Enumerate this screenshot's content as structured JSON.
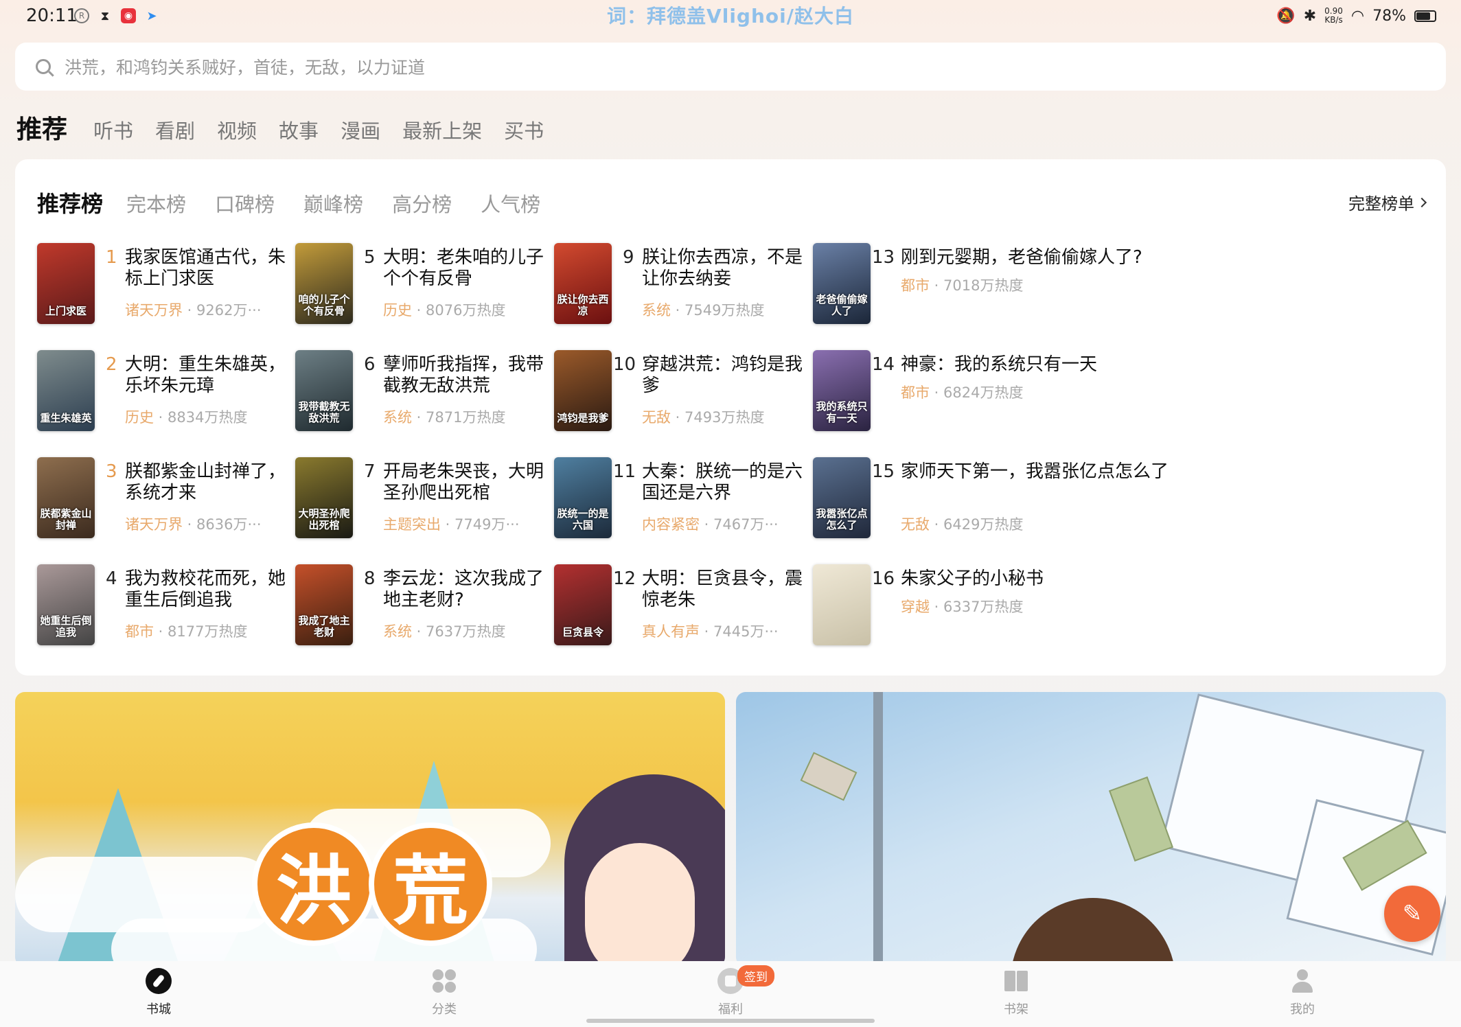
{
  "status": {
    "time": "20:11",
    "lyric": "词：拜德盖Vlighoi/赵大白",
    "net_speed": "0.90",
    "net_unit": "KB/s",
    "battery": "78%",
    "battery_level": 0.78
  },
  "search": {
    "placeholder": "洪荒，和鸿钧关系贼好，首徒，无敌，以力证道"
  },
  "channels": [
    "推荐",
    "听书",
    "看剧",
    "视频",
    "故事",
    "漫画",
    "最新上架",
    "买书"
  ],
  "rank": {
    "tabs": [
      "推荐榜",
      "完本榜",
      "口碑榜",
      "巅峰榜",
      "高分榜",
      "人气榜"
    ],
    "full_list": "完整榜单",
    "books": [
      {
        "num": "1",
        "title": "我家医馆通古代，朱标上门求医",
        "tag": "诸天万界",
        "heat": " · 9262万···",
        "cover": "上门求医"
      },
      {
        "num": "2",
        "title": "大明：重生朱雄英，乐坏朱元璋",
        "tag": "历史",
        "heat": " · 8834万热度",
        "cover": "重生朱雄英"
      },
      {
        "num": "3",
        "title": "朕都紫金山封禅了，系统才来",
        "tag": "诸天万界",
        "heat": " · 8636万···",
        "cover": "朕都紫金山封禅"
      },
      {
        "num": "4",
        "title": "我为救校花而死，她重生后倒追我",
        "tag": "都市",
        "heat": " · 8177万热度",
        "cover": "她重生后倒追我"
      },
      {
        "num": "5",
        "title": "大明：老朱咱的儿子个个有反骨",
        "tag": "历史",
        "heat": " · 8076万热度",
        "cover": "咱的儿子个个有反骨"
      },
      {
        "num": "6",
        "title": "孽师听我指挥，我带截教无敌洪荒",
        "tag": "系统",
        "heat": " · 7871万热度",
        "cover": "我带截教无敌洪荒"
      },
      {
        "num": "7",
        "title": "开局老朱哭丧，大明圣孙爬出死棺",
        "tag": "主题突出",
        "heat": " · 7749万···",
        "cover": "大明圣孙爬出死棺"
      },
      {
        "num": "8",
        "title": "李云龙：这次我成了地主老财?",
        "tag": "系统",
        "heat": " · 7637万热度",
        "cover": "我成了地主老财"
      },
      {
        "num": "9",
        "title": "朕让你去西凉，不是让你去纳妾",
        "tag": "系统",
        "heat": " · 7549万热度",
        "cover": "朕让你去西凉"
      },
      {
        "num": "10",
        "title": "穿越洪荒：鸿钧是我爹",
        "tag": "无敌",
        "heat": " · 7493万热度",
        "cover": "鸿钧是我爹"
      },
      {
        "num": "11",
        "title": "大秦：朕统一的是六国还是六界",
        "tag": "内容紧密",
        "heat": " · 7467万···",
        "cover": "朕统一的是六国"
      },
      {
        "num": "12",
        "title": "大明：巨贪县令，震惊老朱",
        "tag": "真人有声",
        "heat": " · 7445万···",
        "cover": "巨贪县令"
      },
      {
        "num": "13",
        "title": "刚到元婴期，老爸偷偷嫁人了?",
        "tag": "都市",
        "heat": " · 7018万热度",
        "cover": "老爸偷偷嫁人了"
      },
      {
        "num": "14",
        "title": "神豪：我的系统只有一天",
        "tag": "都市",
        "heat": " · 6824万热度",
        "cover": "我的系统只有一天"
      },
      {
        "num": "15",
        "title": "家师天下第一，我嚣张亿点怎么了",
        "tag": "无敌",
        "heat": " · 6429万热度",
        "cover": "我嚣张亿点怎么了"
      },
      {
        "num": "16",
        "title": "朱家父子的小秘书",
        "tag": "穿越",
        "heat": " · 6337万热度",
        "cover": ""
      }
    ]
  },
  "banners": {
    "left_text": "洪荒"
  },
  "nav": {
    "items": [
      "书城",
      "分类",
      "福利",
      "书架",
      "我的"
    ],
    "badge": "签到"
  },
  "colors": {
    "accent": "#f26a3a",
    "tag": "#e8a96b",
    "rank_top3": "#e59a4e"
  }
}
